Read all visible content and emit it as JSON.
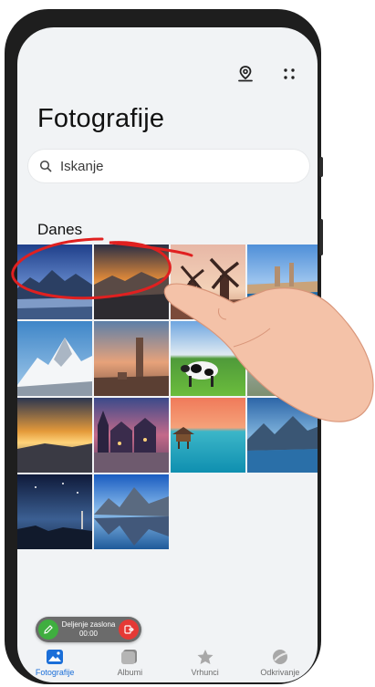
{
  "header": {
    "title": "Fotografije",
    "actions": [
      {
        "name": "map-location-icon"
      },
      {
        "name": "more-icon"
      }
    ]
  },
  "search": {
    "placeholder": "Iskanje"
  },
  "section": {
    "label": "Danes"
  },
  "photos": [
    {
      "name": "photo-mountain-lake"
    },
    {
      "name": "photo-sunset-mountains"
    },
    {
      "name": "photo-windmills"
    },
    {
      "name": "photo-harbor-town"
    },
    {
      "name": "photo-snow-peak"
    },
    {
      "name": "photo-tower-ruins"
    },
    {
      "name": "photo-cow-field"
    },
    {
      "name": "photo-partial"
    },
    {
      "name": "photo-golden-sunrise"
    },
    {
      "name": "photo-old-town"
    },
    {
      "name": "photo-tropical-resort"
    },
    {
      "name": "photo-blue-lake-mountains"
    },
    {
      "name": "photo-night-coast"
    },
    {
      "name": "photo-mountain-reflection"
    }
  ],
  "screen_share": {
    "label": "Deljenje zaslona",
    "time": "00:00"
  },
  "nav": {
    "items": [
      {
        "label": "Fotografije",
        "icon": "photos-icon",
        "active": true
      },
      {
        "label": "Albumi",
        "icon": "albums-icon",
        "active": false
      },
      {
        "label": "Vrhunci",
        "icon": "highlights-star-icon",
        "active": false
      },
      {
        "label": "Odkrivanje",
        "icon": "discover-icon",
        "active": false
      }
    ]
  },
  "colors": {
    "accent": "#1a6ed8",
    "annotation": "#e02020",
    "screen_bg": "#f1f3f5"
  }
}
